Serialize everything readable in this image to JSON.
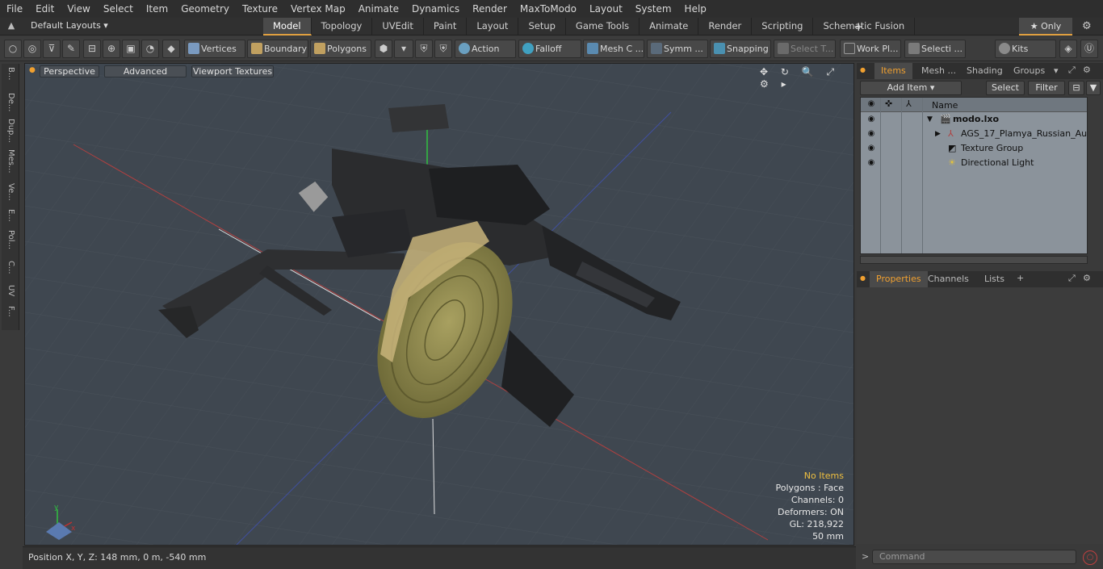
{
  "menu": [
    "File",
    "Edit",
    "View",
    "Select",
    "Item",
    "Geometry",
    "Texture",
    "Vertex Map",
    "Animate",
    "Dynamics",
    "Render",
    "MaxToModo",
    "Layout",
    "System",
    "Help"
  ],
  "layoutbar": {
    "layouts_label": "Default Layouts ▾",
    "tabs": [
      "Model",
      "Topology",
      "UVEdit",
      "Paint",
      "Layout",
      "Setup",
      "Game Tools",
      "Animate",
      "Render",
      "Scripting",
      "Schematic Fusion"
    ],
    "active_tab": "Model",
    "plus": "+",
    "only_label": "★ Only",
    "gear": "⚙"
  },
  "toolbar": {
    "vertices": "Vertices",
    "boundary": "Boundary",
    "polygons": "Polygons",
    "action": "Action",
    "falloff": "Falloff",
    "mesh": "Mesh C ...",
    "symm": "Symm ...",
    "snapping": "Snapping",
    "select_t": "Select T...",
    "work_pl": "Work Pl...",
    "selecti": "Selecti ...",
    "kits": "Kits"
  },
  "left_tabs": [
    "B...",
    "De...",
    "Dup...",
    "Mes...",
    "Ve...",
    "E...",
    "Pol...",
    "C...",
    "UV",
    "F..."
  ],
  "viewport": {
    "perspective": "Perspective",
    "advanced": "Advanced",
    "viewport_textures": "Viewport Textures",
    "icons": "✥ ↻ 🔍 ⤢ ⚙ ▸",
    "stats": {
      "selection": "No Items",
      "polygons": "Polygons : Face",
      "channels": "Channels: 0",
      "deformers": "Deformers: ON",
      "gl": "GL: 218,922",
      "scale": "50 mm"
    },
    "axis_y": "y",
    "axis_x": "x",
    "colors": {
      "selection": "#f0c040",
      "background": "#3f4750"
    }
  },
  "status": {
    "position": "Position X, Y, Z:   148 mm, 0 m, -540 mm"
  },
  "right_panel": {
    "top_tabs": [
      "Items",
      "Mesh ...",
      "Shading",
      "Groups"
    ],
    "active_top_tab": "Items",
    "add_item": "Add Item",
    "select": "Select",
    "filter": "Filter",
    "name_header": "Name",
    "tree": [
      {
        "name": "modo.lxo",
        "icon": "scene-icon"
      },
      {
        "name": "AGS_17_Plamya_Russian_Au ...",
        "icon": "mesh-icon"
      },
      {
        "name": "Texture Group",
        "icon": "texture-icon"
      },
      {
        "name": "Directional Light",
        "icon": "light-icon"
      }
    ],
    "bottom_tabs": [
      "Properties",
      "Channels",
      "Lists"
    ],
    "active_bottom_tab": "Properties",
    "plus": "+",
    "command_placeholder": "Command",
    "prompt": ">"
  }
}
